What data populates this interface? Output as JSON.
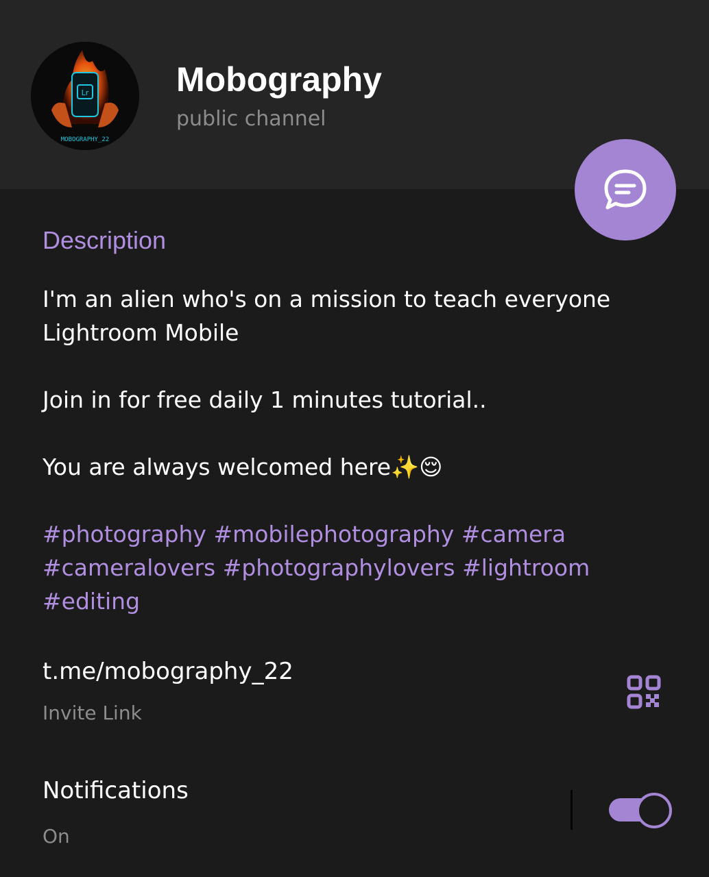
{
  "header": {
    "title": "Mobography",
    "subtitle": "public channel",
    "avatar_caption": "MOBOGRAPHY_22",
    "avatar_app_badge": "Lr"
  },
  "description": {
    "heading": "Description",
    "line1": "I'm an alien who's on a mission to teach everyone Lightroom Mobile",
    "line2": "Join in for free daily 1 minutes tutorial..",
    "line3": "You are always welcomed here✨😌",
    "hashtags": "#photography #mobilephotography #camera #cameralovers #photographylovers #lightroom #editing"
  },
  "invite": {
    "link": "t.me/mobography_22",
    "label": "Invite Link",
    "icon": "qr-code-icon"
  },
  "notifications": {
    "label": "Notifications",
    "status": "On",
    "enabled": true
  },
  "fab": {
    "icon": "chat-bubble-icon"
  },
  "colors": {
    "accent": "#a485d3",
    "background": "#1b1b1c",
    "header_background": "#252526"
  }
}
